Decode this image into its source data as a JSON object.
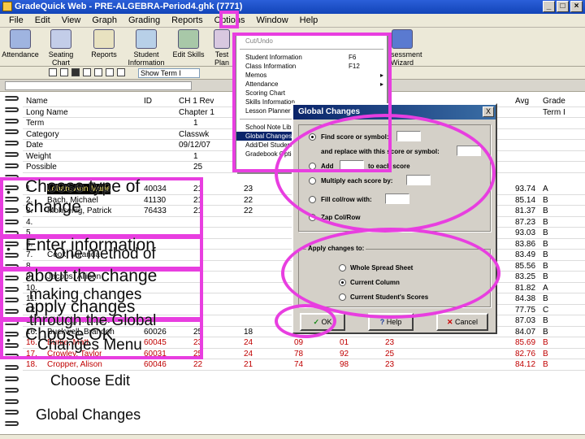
{
  "window": {
    "title": "GradeQuick Web - PRE-ALGEBRA-Period4.ghk (7771)"
  },
  "menubar": [
    "File",
    "Edit",
    "View",
    "Graph",
    "Grading",
    "Reports",
    "Options",
    "Window",
    "Help"
  ],
  "toolbar": {
    "buttons": [
      "Attendance",
      "Seating Chart",
      "Reports",
      "Student Information",
      "Edit Skills",
      "Test Plan",
      "Assessment Wizard"
    ]
  },
  "term_select": "Show Term I",
  "grid": {
    "headers": {
      "label_col": [
        "Name",
        "Long Name",
        "Term",
        "Category",
        "Date",
        "Weight",
        "Possible"
      ],
      "id": "ID",
      "ch1rev": [
        "CH 1 Rev",
        "Chapter 1",
        "1",
        "Classwk",
        "09/12/07",
        "1",
        "25"
      ],
      "col3": [
        "",
        "",
        "",
        "",
        "",
        "",
        "25"
      ],
      "avg": "Avg",
      "grade": [
        "Grade",
        "Term I"
      ]
    },
    "students": [
      {
        "num": "1.",
        "name": "Lohan, Ann Marie",
        "id": "40034",
        "c1": "21",
        "c2": "23",
        "avg": "93.74",
        "grade": "A"
      },
      {
        "num": "2.",
        "name": "Bach, Michael",
        "id": "41130",
        "c1": "21",
        "c2": "22",
        "avg": "85.14",
        "grade": "B"
      },
      {
        "num": "3.",
        "name": "Mohsenig, Patrick",
        "id": "76433",
        "c1": "21",
        "c2": "22",
        "avg": "81.37",
        "grade": "B"
      },
      {
        "num": "4.",
        "name": "",
        "id": "",
        "c1": "",
        "c2": "",
        "avg": "87.23",
        "grade": "B"
      },
      {
        "num": "5.",
        "name": "",
        "id": "",
        "c1": "",
        "c2": "",
        "avg": "93.03",
        "grade": "B"
      },
      {
        "num": "6.",
        "name": "",
        "id": "",
        "c1": "",
        "c2": "",
        "avg": "83.86",
        "grade": "B"
      },
      {
        "num": "7.",
        "name": "Cook, Miranda",
        "id": "",
        "c1": "",
        "c2": "",
        "avg": "83.49",
        "grade": "B"
      },
      {
        "num": "8.",
        "name": "",
        "id": "",
        "c1": "",
        "c2": "",
        "avg": "85.56",
        "grade": "B"
      },
      {
        "num": "9.",
        "name": "Jacobs, Allison",
        "id": "",
        "c1": "",
        "c2": "",
        "avg": "83.25",
        "grade": "B"
      },
      {
        "num": "10.",
        "name": "",
        "id": "",
        "c1": "",
        "c2": "",
        "avg": "81.82",
        "grade": "A"
      },
      {
        "num": "11.",
        "name": "",
        "id": "",
        "c1": "",
        "c2": "",
        "avg": "84.38",
        "grade": "B"
      },
      {
        "num": "12.",
        "name": "",
        "id": "",
        "c1": "",
        "c2": "",
        "avg": "77.75",
        "grade": "C"
      },
      {
        "num": "13.",
        "name": "Cisherg, Matthew",
        "id": "",
        "c1": "",
        "c2": "",
        "c3": "35",
        "c4": "88",
        "c5": "47",
        "nc": "NC",
        "avg": "87.03",
        "grade": "B"
      },
      {
        "num": "16.",
        "name": "Buckwell, Brandon",
        "id": "60026",
        "c1": "25",
        "c2": "18",
        "c3": "31",
        "c4": "86",
        "c5": "20",
        "avg": "84.07",
        "grade": "B"
      },
      {
        "num": "16.",
        "name": "Burke, Matt",
        "id": "60045",
        "c1": "23",
        "c2": "24",
        "c3": "09",
        "c4": "01",
        "c5": "23",
        "avg": "85.69",
        "grade": "B"
      },
      {
        "num": "17.",
        "name": "Crowley, Taylor",
        "id": "60031",
        "c1": "25",
        "c2": "24",
        "c3": "78",
        "c4": "92",
        "c5": "25",
        "avg": "82.76",
        "grade": "B"
      },
      {
        "num": "18.",
        "name": "Cropper, Alison",
        "id": "60046",
        "c1": "22",
        "c2": "21",
        "c3": "74",
        "c4": "98",
        "c5": "23",
        "avg": "84.12",
        "grade": "B"
      }
    ]
  },
  "edit_menu": {
    "items": [
      {
        "label": "Cut/Undo",
        "shortcut": "",
        "arrow": false,
        "disabled": true
      },
      {
        "label": "Student Information",
        "shortcut": "F6",
        "arrow": false
      },
      {
        "label": "Class Information",
        "shortcut": "F12",
        "arrow": false
      },
      {
        "label": "Memos",
        "shortcut": "",
        "arrow": true
      },
      {
        "label": "Attendance",
        "shortcut": "",
        "arrow": true
      },
      {
        "label": "Scoring Chart",
        "shortcut": "",
        "arrow": false
      },
      {
        "label": "Skills Information",
        "shortcut": "",
        "arrow": false
      },
      {
        "label": "Lesson Planner",
        "shortcut": "",
        "arrow": false
      },
      {
        "label": "School Note Library",
        "shortcut": "",
        "arrow": false
      },
      {
        "label": "Global Changes",
        "shortcut": "",
        "arrow": false,
        "selected": true
      },
      {
        "label": "Add/Del Student",
        "shortcut": "",
        "arrow": false
      },
      {
        "label": "Gradebook Options",
        "shortcut": "",
        "arrow": false
      }
    ]
  },
  "dialog": {
    "title": "Global Changes",
    "close": "X",
    "options": {
      "find": "Find score or symbol:",
      "replace": "and replace with this score or symbol:",
      "add": "Add",
      "add_suffix": "to each score",
      "multiply": "Multiply each score by:",
      "fill": "Fill col/row with:",
      "zap": "Zap Col/Row"
    },
    "apply_group": {
      "label": "Apply changes to:",
      "options": [
        "Whole Spread Sheet",
        "Current Column",
        "Current Student's Scores"
      ]
    },
    "ok": "OK",
    "help": "Help",
    "cancel": "Cancel"
  },
  "overlay": {
    "lines": [
      "Choose type of",
      "change",
      "Enter information",
      "One method of",
      "about the change",
      "making changes",
      "apply changes",
      "through the Global",
      "Changes Menu",
      "Choose OK",
      "Choose Edit",
      "Global Changes"
    ],
    "ok_arrow": "OK"
  }
}
